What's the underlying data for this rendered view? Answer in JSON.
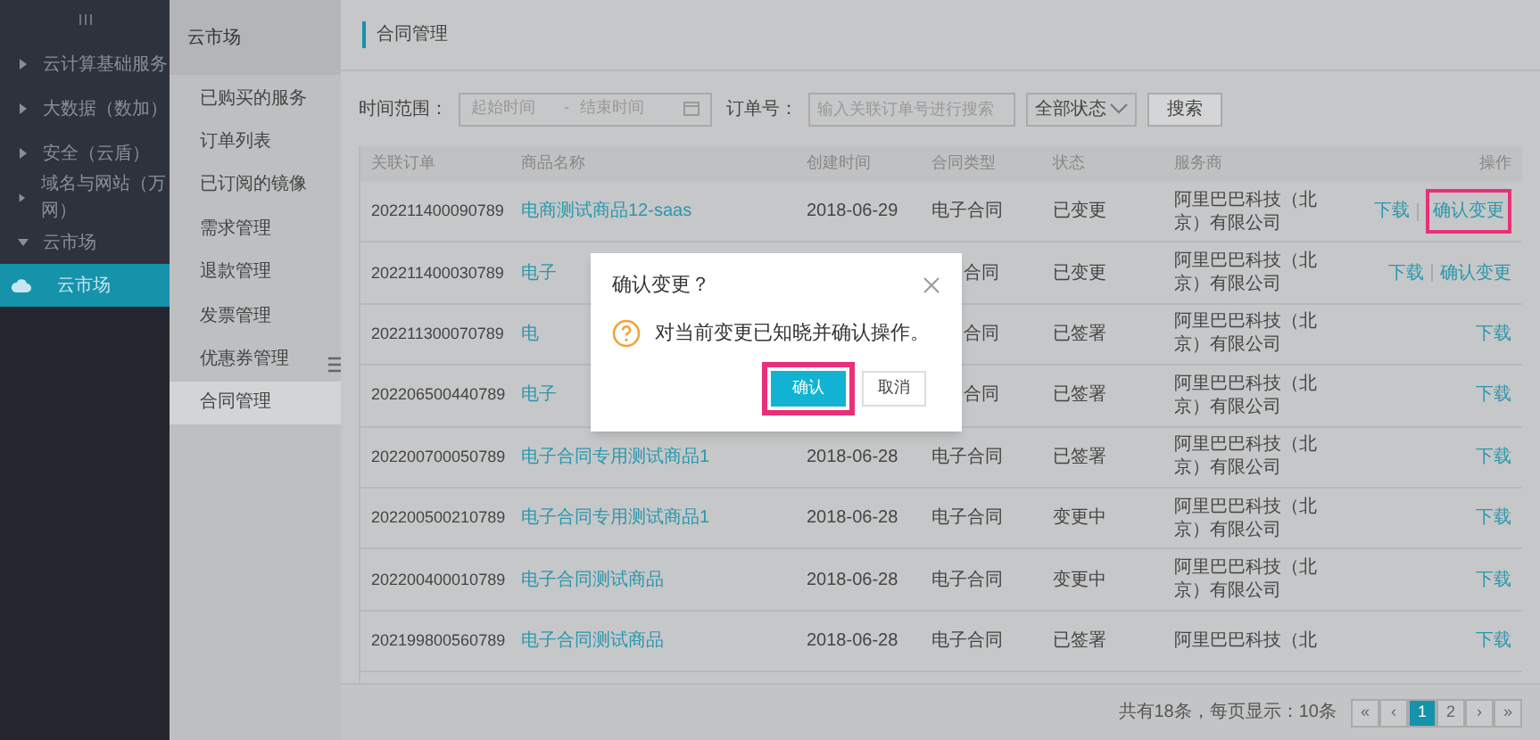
{
  "nav": {
    "items": [
      {
        "label": "云计算基础服务",
        "expanded": false
      },
      {
        "label": "大数据（数加）",
        "expanded": false
      },
      {
        "label": "安全（云盾）",
        "expanded": false
      },
      {
        "label": "域名与网站（万网）",
        "expanded": false
      },
      {
        "label": "云市场",
        "expanded": true,
        "children": [
          {
            "label": "云市场",
            "selected": true
          }
        ]
      }
    ]
  },
  "subnav": {
    "title": "云市场",
    "items": [
      {
        "label": "已购买的服务",
        "selected": false
      },
      {
        "label": "订单列表",
        "selected": false
      },
      {
        "label": "已订阅的镜像",
        "selected": false
      },
      {
        "label": "需求管理",
        "selected": false
      },
      {
        "label": "退款管理",
        "selected": false
      },
      {
        "label": "发票管理",
        "selected": false
      },
      {
        "label": "优惠券管理",
        "selected": false
      },
      {
        "label": "合同管理",
        "selected": true
      }
    ]
  },
  "page_title": "合同管理",
  "filters": {
    "time_label": "时间范围：",
    "start_placeholder": "起始时间",
    "separator": "-",
    "end_placeholder": "结束时间",
    "order_label": "订单号：",
    "order_placeholder": "输入关联订单号进行搜索",
    "status_value": "全部状态",
    "search_button": "搜索"
  },
  "table": {
    "columns": [
      "关联订单",
      "商品名称",
      "创建时间",
      "合同类型",
      "状态",
      "服务商",
      "操作"
    ],
    "rows": [
      {
        "order": "202211400090789",
        "product": "电商测试商品12-saas",
        "created": "2018-06-29",
        "type": "电子合同",
        "status": "已变更",
        "provider": "阿里巴巴科技（北京）有限公司",
        "actions": [
          {
            "label": "下载",
            "highlighted": false
          },
          {
            "label": "确认变更",
            "highlighted": true
          }
        ]
      },
      {
        "order": "202211400030789",
        "product": "电子",
        "type": "合同",
        "status": "已变更",
        "provider": "阿里巴巴科技（北京）有限公司",
        "actions": [
          {
            "label": "下载",
            "highlighted": false
          },
          {
            "label": "确认变更",
            "highlighted": false
          }
        ]
      },
      {
        "order": "202211300070789",
        "product": "电",
        "type": "合同",
        "status": "已签署",
        "provider": "阿里巴巴科技（北京）有限公司",
        "actions": [
          {
            "label": "下载",
            "highlighted": false
          }
        ]
      },
      {
        "order": "202206500440789",
        "product": "电子",
        "type": "合同",
        "status": "已签署",
        "provider": "阿里巴巴科技（北京）有限公司",
        "actions": [
          {
            "label": "下载",
            "highlighted": false
          }
        ]
      },
      {
        "order": "202200700050789",
        "product": "电子合同专用测试商品1",
        "created": "2018-06-28",
        "type": "电子合同",
        "status": "已签署",
        "provider": "阿里巴巴科技（北京）有限公司",
        "actions": [
          {
            "label": "下载",
            "highlighted": false
          }
        ]
      },
      {
        "order": "202200500210789",
        "product": "电子合同专用测试商品1",
        "created": "2018-06-28",
        "type": "电子合同",
        "status": "变更中",
        "provider": "阿里巴巴科技（北京）有限公司",
        "actions": [
          {
            "label": "下载",
            "highlighted": false
          }
        ]
      },
      {
        "order": "202200400010789",
        "product": "电子合同测试商品",
        "created": "2018-06-28",
        "type": "电子合同",
        "status": "变更中",
        "provider": "阿里巴巴科技（北京）有限公司",
        "actions": [
          {
            "label": "下载",
            "highlighted": false
          }
        ]
      },
      {
        "order": "202199800560789",
        "product": "电子合同测试商品",
        "created": "2018-06-28",
        "type": "电子合同",
        "status": "已签署",
        "provider": "阿里巴巴科技（北",
        "actions": [
          {
            "label": "下载",
            "highlighted": false
          }
        ]
      }
    ]
  },
  "pagination": {
    "summary": "共有18条，每页显示：10条",
    "buttons": [
      {
        "label": "«",
        "selected": false
      },
      {
        "label": "‹",
        "selected": false
      },
      {
        "label": "1",
        "selected": true
      },
      {
        "label": "2",
        "selected": false
      },
      {
        "label": "›",
        "selected": false
      },
      {
        "label": "»",
        "selected": false
      }
    ]
  },
  "dialog": {
    "title": "确认变更？",
    "message": "对当前变更已知晓并确认操作。",
    "confirm": {
      "label": "确认",
      "highlighted": true
    },
    "cancel": "取消"
  }
}
